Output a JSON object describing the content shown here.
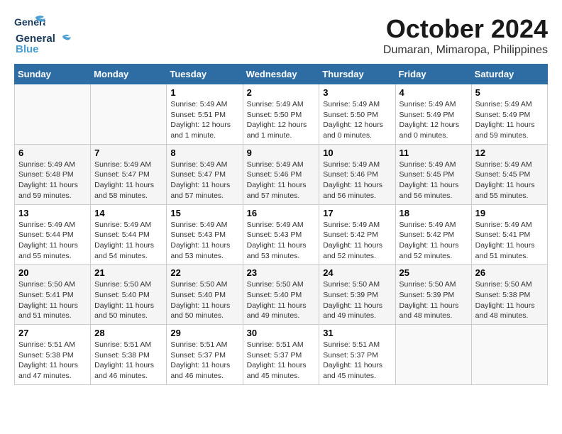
{
  "header": {
    "logo_line1": "General",
    "logo_line2": "Blue",
    "month_year": "October 2024",
    "location": "Dumaran, Mimaropa, Philippines"
  },
  "weekdays": [
    "Sunday",
    "Monday",
    "Tuesday",
    "Wednesday",
    "Thursday",
    "Friday",
    "Saturday"
  ],
  "weeks": [
    [
      {
        "day": "",
        "info": ""
      },
      {
        "day": "",
        "info": ""
      },
      {
        "day": "1",
        "info": "Sunrise: 5:49 AM\nSunset: 5:51 PM\nDaylight: 12 hours and 1 minute."
      },
      {
        "day": "2",
        "info": "Sunrise: 5:49 AM\nSunset: 5:50 PM\nDaylight: 12 hours and 1 minute."
      },
      {
        "day": "3",
        "info": "Sunrise: 5:49 AM\nSunset: 5:50 PM\nDaylight: 12 hours and 0 minutes."
      },
      {
        "day": "4",
        "info": "Sunrise: 5:49 AM\nSunset: 5:49 PM\nDaylight: 12 hours and 0 minutes."
      },
      {
        "day": "5",
        "info": "Sunrise: 5:49 AM\nSunset: 5:49 PM\nDaylight: 11 hours and 59 minutes."
      }
    ],
    [
      {
        "day": "6",
        "info": "Sunrise: 5:49 AM\nSunset: 5:48 PM\nDaylight: 11 hours and 59 minutes."
      },
      {
        "day": "7",
        "info": "Sunrise: 5:49 AM\nSunset: 5:47 PM\nDaylight: 11 hours and 58 minutes."
      },
      {
        "day": "8",
        "info": "Sunrise: 5:49 AM\nSunset: 5:47 PM\nDaylight: 11 hours and 57 minutes."
      },
      {
        "day": "9",
        "info": "Sunrise: 5:49 AM\nSunset: 5:46 PM\nDaylight: 11 hours and 57 minutes."
      },
      {
        "day": "10",
        "info": "Sunrise: 5:49 AM\nSunset: 5:46 PM\nDaylight: 11 hours and 56 minutes."
      },
      {
        "day": "11",
        "info": "Sunrise: 5:49 AM\nSunset: 5:45 PM\nDaylight: 11 hours and 56 minutes."
      },
      {
        "day": "12",
        "info": "Sunrise: 5:49 AM\nSunset: 5:45 PM\nDaylight: 11 hours and 55 minutes."
      }
    ],
    [
      {
        "day": "13",
        "info": "Sunrise: 5:49 AM\nSunset: 5:44 PM\nDaylight: 11 hours and 55 minutes."
      },
      {
        "day": "14",
        "info": "Sunrise: 5:49 AM\nSunset: 5:44 PM\nDaylight: 11 hours and 54 minutes."
      },
      {
        "day": "15",
        "info": "Sunrise: 5:49 AM\nSunset: 5:43 PM\nDaylight: 11 hours and 53 minutes."
      },
      {
        "day": "16",
        "info": "Sunrise: 5:49 AM\nSunset: 5:43 PM\nDaylight: 11 hours and 53 minutes."
      },
      {
        "day": "17",
        "info": "Sunrise: 5:49 AM\nSunset: 5:42 PM\nDaylight: 11 hours and 52 minutes."
      },
      {
        "day": "18",
        "info": "Sunrise: 5:49 AM\nSunset: 5:42 PM\nDaylight: 11 hours and 52 minutes."
      },
      {
        "day": "19",
        "info": "Sunrise: 5:49 AM\nSunset: 5:41 PM\nDaylight: 11 hours and 51 minutes."
      }
    ],
    [
      {
        "day": "20",
        "info": "Sunrise: 5:50 AM\nSunset: 5:41 PM\nDaylight: 11 hours and 51 minutes."
      },
      {
        "day": "21",
        "info": "Sunrise: 5:50 AM\nSunset: 5:40 PM\nDaylight: 11 hours and 50 minutes."
      },
      {
        "day": "22",
        "info": "Sunrise: 5:50 AM\nSunset: 5:40 PM\nDaylight: 11 hours and 50 minutes."
      },
      {
        "day": "23",
        "info": "Sunrise: 5:50 AM\nSunset: 5:40 PM\nDaylight: 11 hours and 49 minutes."
      },
      {
        "day": "24",
        "info": "Sunrise: 5:50 AM\nSunset: 5:39 PM\nDaylight: 11 hours and 49 minutes."
      },
      {
        "day": "25",
        "info": "Sunrise: 5:50 AM\nSunset: 5:39 PM\nDaylight: 11 hours and 48 minutes."
      },
      {
        "day": "26",
        "info": "Sunrise: 5:50 AM\nSunset: 5:38 PM\nDaylight: 11 hours and 48 minutes."
      }
    ],
    [
      {
        "day": "27",
        "info": "Sunrise: 5:51 AM\nSunset: 5:38 PM\nDaylight: 11 hours and 47 minutes."
      },
      {
        "day": "28",
        "info": "Sunrise: 5:51 AM\nSunset: 5:38 PM\nDaylight: 11 hours and 46 minutes."
      },
      {
        "day": "29",
        "info": "Sunrise: 5:51 AM\nSunset: 5:37 PM\nDaylight: 11 hours and 46 minutes."
      },
      {
        "day": "30",
        "info": "Sunrise: 5:51 AM\nSunset: 5:37 PM\nDaylight: 11 hours and 45 minutes."
      },
      {
        "day": "31",
        "info": "Sunrise: 5:51 AM\nSunset: 5:37 PM\nDaylight: 11 hours and 45 minutes."
      },
      {
        "day": "",
        "info": ""
      },
      {
        "day": "",
        "info": ""
      }
    ]
  ]
}
